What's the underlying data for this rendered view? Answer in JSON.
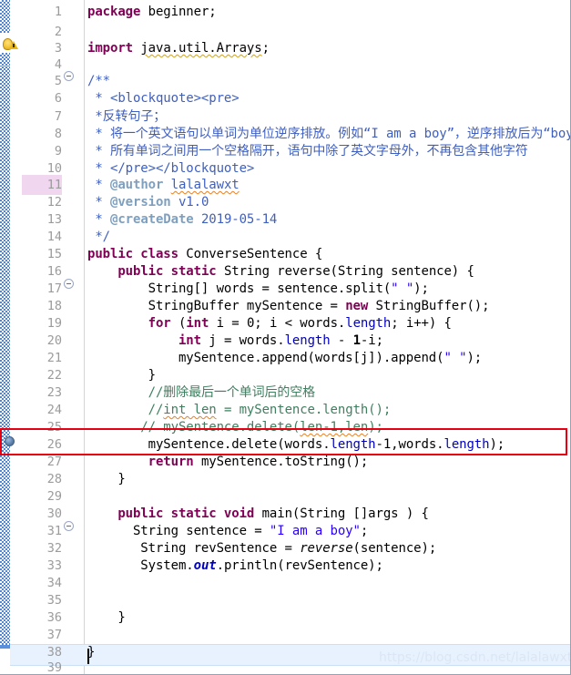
{
  "editor": {
    "type": "java-source-editor",
    "watermark": "https://blog.csdn.net/lalalawxt",
    "total_lines": 39,
    "current_line": 39,
    "highlighted_line_number": 11,
    "breakpoint_line": 26,
    "warning_line": 3,
    "fold_lines": [
      5,
      16,
      30
    ],
    "annotation_box_line": 26,
    "colors": {
      "keyword": "#7f0055",
      "string": "#2a00ff",
      "comment": "#3f7f5f",
      "javadoc": "#3f5fbf",
      "javadoc_tag": "#7f9fbf",
      "field": "#0000c0",
      "line_number": "#9b9b9b",
      "annotation_box": "#e60012",
      "current_line_bg": "#e8f2fe",
      "change_bar": "#4f86d6",
      "search_match_bg": "#f0d6ee"
    }
  },
  "lines": [
    {
      "n": 1,
      "text": "package beginner;"
    },
    {
      "n": 2,
      "text": ""
    },
    {
      "n": 3,
      "text": "import java.util.Arrays;"
    },
    {
      "n": 4,
      "text": ""
    },
    {
      "n": 5,
      "text": "/**"
    },
    {
      "n": 6,
      "text": " * <blockquote><pre>"
    },
    {
      "n": 7,
      "text": " *反转句子；"
    },
    {
      "n": 8,
      "text": " * 将一个英文语句以单词为单位逆序排放。例如“I am a boy”，逆序排放后为“boy a am I”"
    },
    {
      "n": 9,
      "text": " * 所有单词之间用一个空格隔开，语句中除了英文字母外，不再包含其他字符"
    },
    {
      "n": 10,
      "text": " * </pre></blockquote>"
    },
    {
      "n": 11,
      "text": " * @author lalalawxt"
    },
    {
      "n": 12,
      "text": " * @version v1.0"
    },
    {
      "n": 13,
      "text": " * @createDate 2019-05-14"
    },
    {
      "n": 14,
      "text": " */"
    },
    {
      "n": 15,
      "text": "public class ConverseSentence {"
    },
    {
      "n": 16,
      "text": "    public static String reverse(String sentence) {"
    },
    {
      "n": 17,
      "text": "        String[] words = sentence.split(\" \");"
    },
    {
      "n": 18,
      "text": "        StringBuffer mySentence = new StringBuffer();"
    },
    {
      "n": 19,
      "text": "        for (int i = 0; i < words.length; i++) {"
    },
    {
      "n": 20,
      "text": "            int j = words.length - 1-i;"
    },
    {
      "n": 21,
      "text": "            mySentence.append(words[j]).append(\" \");"
    },
    {
      "n": 22,
      "text": "        }"
    },
    {
      "n": 23,
      "text": "        //删除最后一个单词后的空格"
    },
    {
      "n": 24,
      "text": "        //int len = mySentence.length();"
    },
    {
      "n": 25,
      "text": "       // mySentence.delete(len-1,len);"
    },
    {
      "n": 26,
      "text": "        mySentence.delete(words.length-1,words.length);"
    },
    {
      "n": 27,
      "text": "        return mySentence.toString();"
    },
    {
      "n": 28,
      "text": "    }"
    },
    {
      "n": 29,
      "text": ""
    },
    {
      "n": 30,
      "text": "    public static void main(String []args ) {"
    },
    {
      "n": 31,
      "text": "      String sentence = \"I am a boy\";"
    },
    {
      "n": 32,
      "text": "       String revSentence = reverse(sentence);"
    },
    {
      "n": 33,
      "text": "       System.out.println(revSentence);"
    },
    {
      "n": 34,
      "text": ""
    },
    {
      "n": 35,
      "text": ""
    },
    {
      "n": 36,
      "text": "    }"
    },
    {
      "n": 37,
      "text": ""
    },
    {
      "n": 38,
      "text": "}"
    },
    {
      "n": 39,
      "text": ""
    }
  ]
}
